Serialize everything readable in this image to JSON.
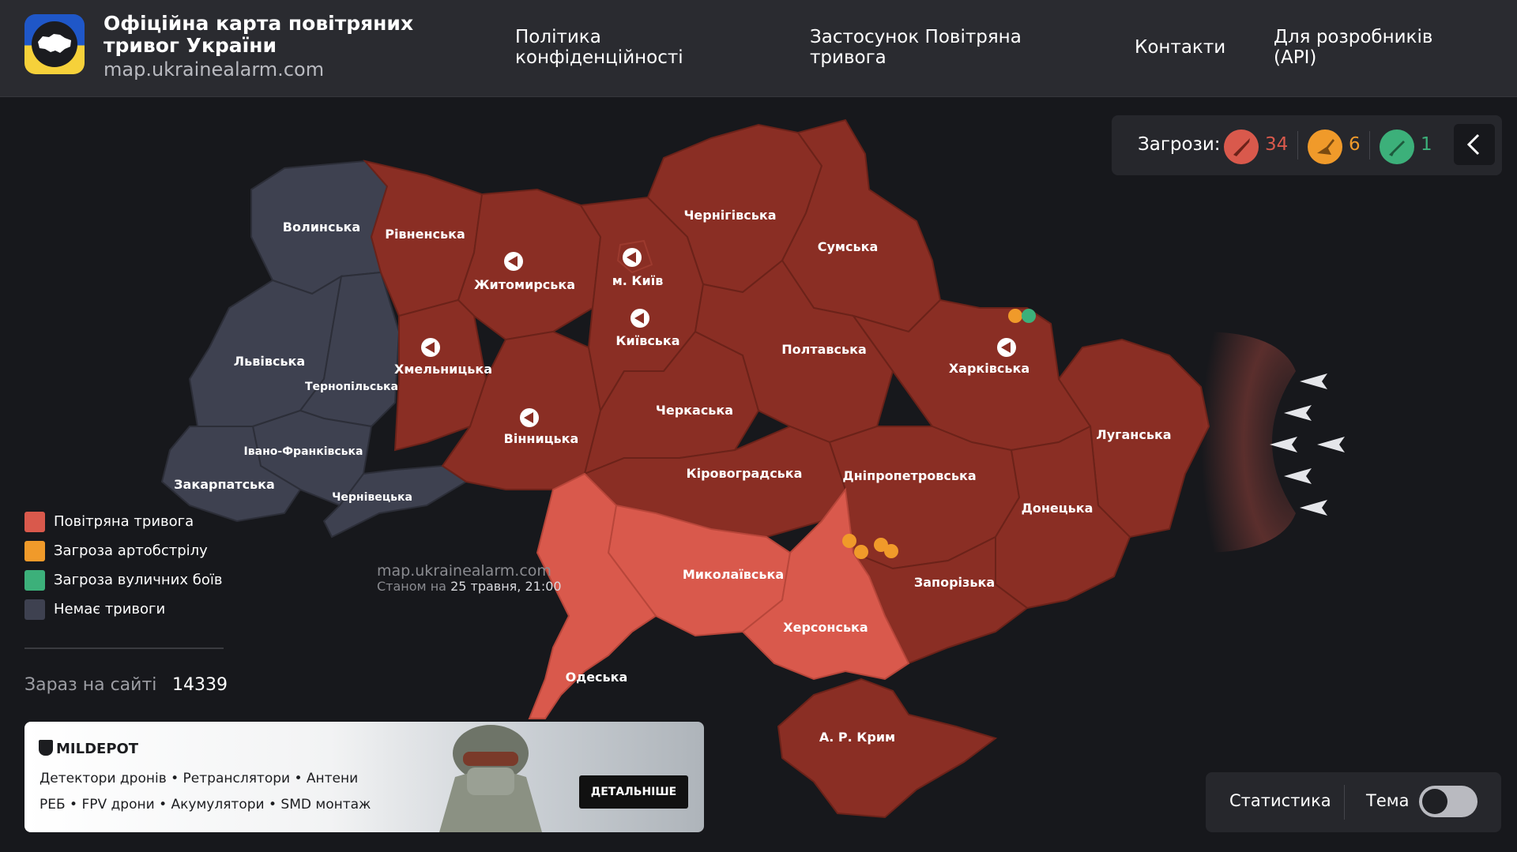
{
  "header": {
    "title": "Офіційна карта повітряних тривог України",
    "url": "map.ukrainealarm.com",
    "nav": [
      {
        "label": "Політика конфіденційності"
      },
      {
        "label": "Застосунок Повітряна тривога"
      },
      {
        "label": "Контакти"
      },
      {
        "label": "Для розробників (API)"
      }
    ]
  },
  "threats": {
    "label": "Загрози:",
    "items": [
      {
        "icon": "missile-icon",
        "count": "34",
        "color": "#d9594c"
      },
      {
        "icon": "artillery-icon",
        "count": "6",
        "color": "#f09a2a"
      },
      {
        "icon": "rifle-icon",
        "count": "1",
        "color": "#3cb07a"
      }
    ]
  },
  "legend": [
    {
      "label": "Повітряна тривога",
      "color": "#d9594c"
    },
    {
      "label": "Загроза артобстрілу",
      "color": "#f09a2a"
    },
    {
      "label": "Загроза вуличних боїв",
      "color": "#3cb07a"
    },
    {
      "label": "Немає тривоги",
      "color": "#3e4150"
    }
  ],
  "online": {
    "label": "Зараз на сайті",
    "count": "14339"
  },
  "watermark": {
    "url": "map.ukrainealarm.com",
    "prefix": "Станом на",
    "date": "25 травня, 21:00"
  },
  "regions": [
    {
      "name": "Волинська"
    },
    {
      "name": "Рівненська"
    },
    {
      "name": "Житомирська"
    },
    {
      "name": "м. Київ"
    },
    {
      "name": "Київська"
    },
    {
      "name": "Чернігівська"
    },
    {
      "name": "Сумська"
    },
    {
      "name": "Львівська"
    },
    {
      "name": "Тернопільська"
    },
    {
      "name": "Хмельницька"
    },
    {
      "name": "Вінницька"
    },
    {
      "name": "Черкаська"
    },
    {
      "name": "Полтавська"
    },
    {
      "name": "Харківська"
    },
    {
      "name": "Луганська"
    },
    {
      "name": "Івано-Франківська"
    },
    {
      "name": "Закарпатська"
    },
    {
      "name": "Чернівецька"
    },
    {
      "name": "Кіровоградська"
    },
    {
      "name": "Дніпропетровська"
    },
    {
      "name": "Донецька"
    },
    {
      "name": "Миколаївська"
    },
    {
      "name": "Запорізька"
    },
    {
      "name": "Херсонська"
    },
    {
      "name": "Одеська"
    },
    {
      "name": "А. Р. Крим"
    }
  ],
  "ad": {
    "brand": "MILDEPOT",
    "line1": "Детектори дронів • Ретранслятори • Антени",
    "line2": "РЕБ • FPV дрони • Акумулятори • SMD монтаж",
    "button": "ДЕТАЛЬНІШЕ"
  },
  "controls": {
    "stats": "Статистика",
    "theme": "Тема"
  },
  "colors": {
    "alert_dark": "#8a2e24",
    "alert_light": "#d9594c",
    "no_alert": "#3e4150"
  }
}
